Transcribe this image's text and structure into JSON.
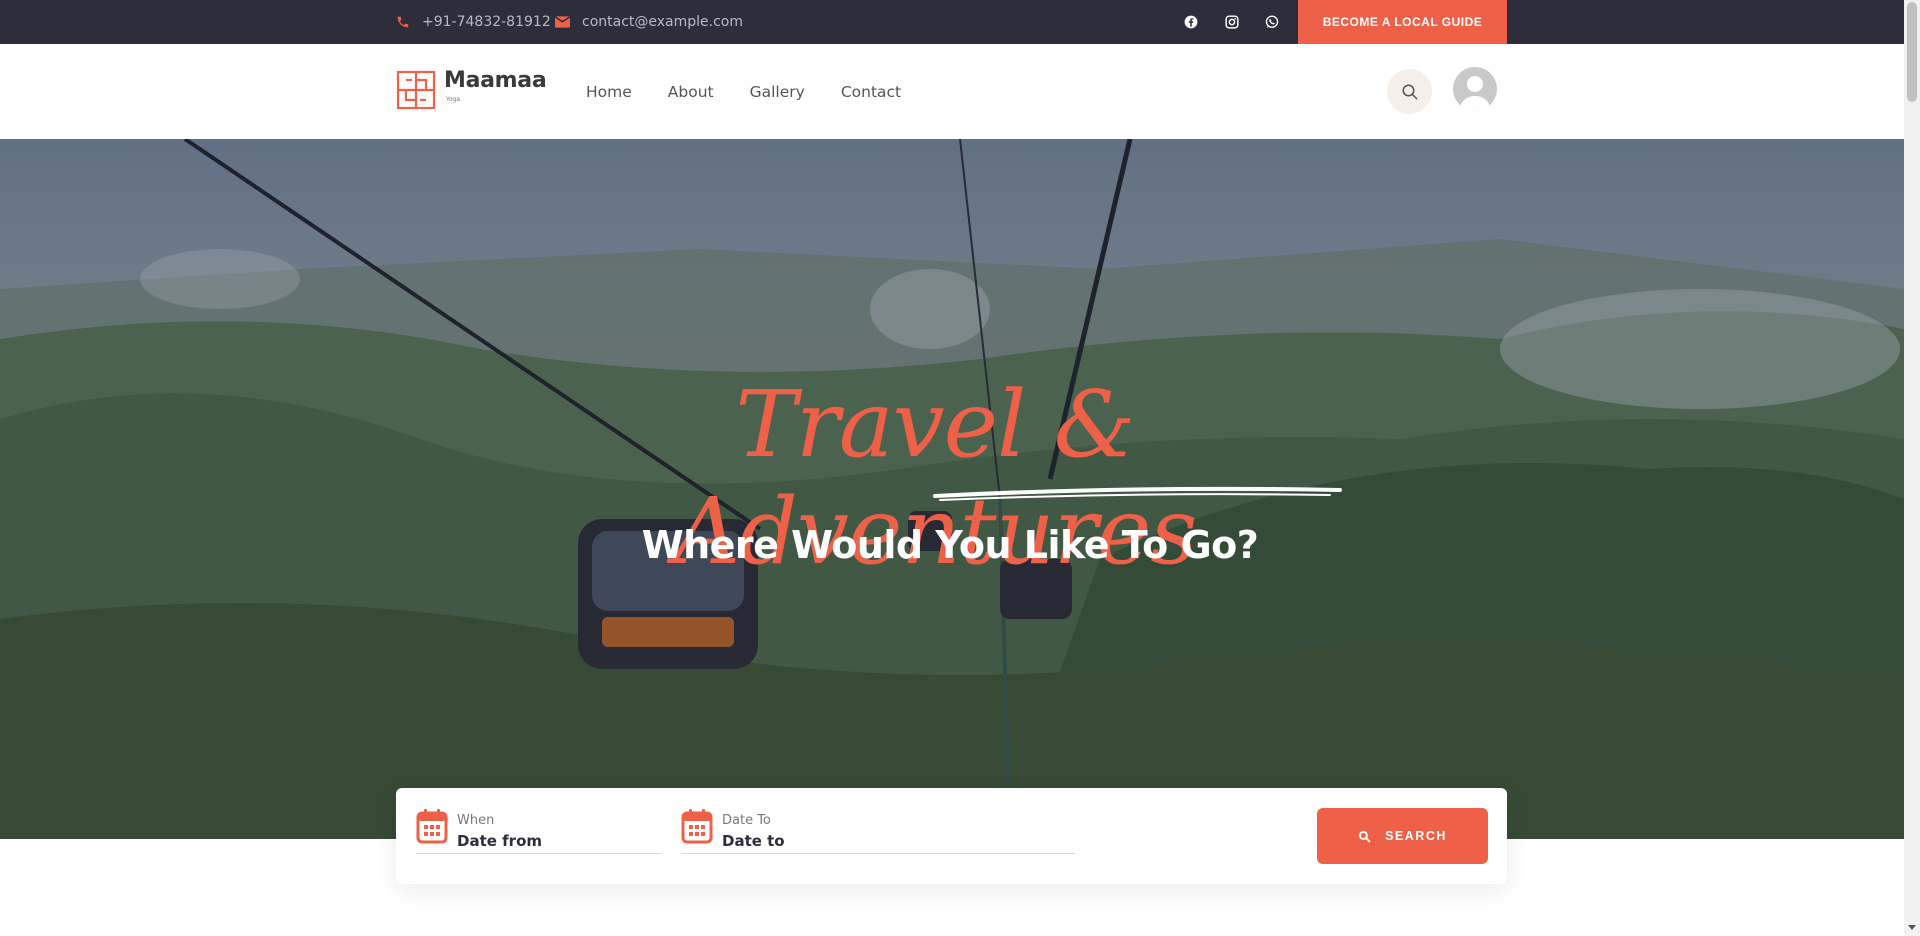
{
  "topbar": {
    "phone": "+91-74832-81912",
    "email": "contact@example.com",
    "social_icons": [
      "facebook-icon",
      "instagram-icon",
      "whatsapp-icon"
    ],
    "guide_button": "BECOME A LOCAL GUIDE"
  },
  "header": {
    "logo_name": "Maamaa",
    "logo_sub": "Yoga",
    "nav": [
      "Home",
      "About",
      "Gallery",
      "Contact"
    ]
  },
  "hero": {
    "script_title": "Travel & Adventures",
    "subtitle": "Where Would You Like To Go?"
  },
  "search": {
    "from_label": "When",
    "from_value": "Date from",
    "to_label": "Date To",
    "to_value": "Date to",
    "button": "SEARCH"
  },
  "colors": {
    "accent": "#ee6148",
    "topbar": "#2d2d3c"
  }
}
